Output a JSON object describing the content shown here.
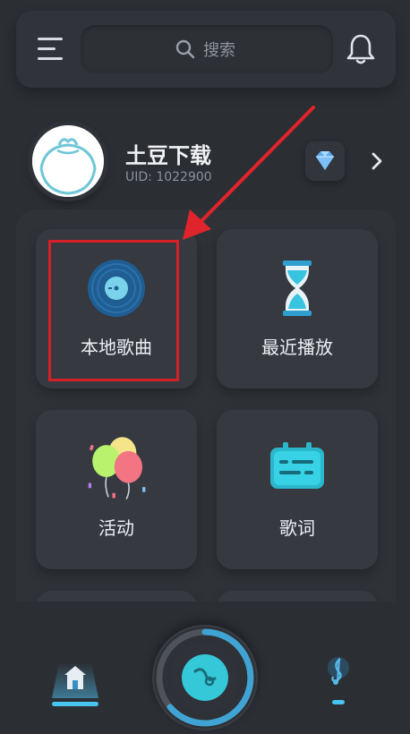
{
  "header": {
    "search_placeholder": "搜索"
  },
  "profile": {
    "name": "土豆下载",
    "uid": "UID: 1022900"
  },
  "grid": {
    "items": [
      {
        "label": "本地歌曲",
        "icon": "vinyl-disc-icon"
      },
      {
        "label": "最近播放",
        "icon": "hourglass-icon"
      },
      {
        "label": "活动",
        "icon": "balloons-icon"
      },
      {
        "label": "歌词",
        "icon": "lyrics-card-icon"
      }
    ]
  },
  "colors": {
    "background": "#2b2e33",
    "card": "#363940",
    "accent": "#2bc5d6",
    "highlight": "#d61f26"
  },
  "bottom_nav": {
    "items": [
      "home-icon",
      "play-button-icon",
      "music-note-icon"
    ]
  }
}
